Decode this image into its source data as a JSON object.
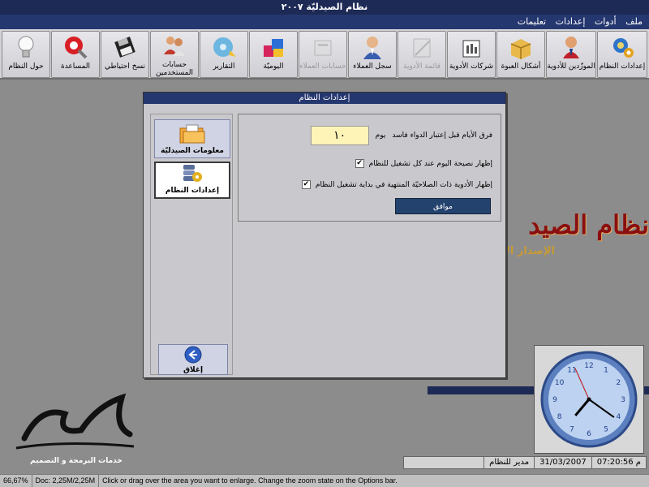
{
  "window": {
    "title": "نظام الصيدليّة ٢٠٠٧"
  },
  "menu": {
    "items": [
      "ملف",
      "أدوات",
      "إعدادات",
      "تعليمات"
    ]
  },
  "toolbar": {
    "buttons": [
      {
        "label": "إعدادات النظام",
        "icon": "gears-icon"
      },
      {
        "label": "الموزّدين للأدوية",
        "icon": "supplier-person-icon"
      },
      {
        "label": "أشكال العبوة",
        "icon": "package-box-icon"
      },
      {
        "label": "شركات الأدوية",
        "icon": "factory-icon"
      },
      {
        "label": "قائمة الأدوية",
        "icon": "drug-list-icon",
        "disabled": true
      },
      {
        "label": "سجل العملاء",
        "icon": "customer-icon"
      },
      {
        "label": "حسابات العملاء",
        "icon": "customer-accounts-icon",
        "disabled": true
      },
      {
        "label": "اليوميّة",
        "icon": "journal-blocks-icon"
      },
      {
        "label": "التقارير",
        "icon": "reports-disc-icon"
      },
      {
        "label": "حسابات المستخدمين",
        "icon": "users-icon"
      },
      {
        "label": "نسخ احتياطي",
        "icon": "floppy-disk-icon"
      },
      {
        "label": "المساعدة",
        "icon": "help-magnifier-icon"
      },
      {
        "label": "حول النظام",
        "icon": "lightbulb-icon"
      }
    ]
  },
  "background": {
    "title": "نظام الصيد",
    "subtitle": "الإصدار الأ"
  },
  "dialog": {
    "title": "إعدادات النظام",
    "side": {
      "pharmacy_info_label": "معلومات الصيدليّة",
      "system_settings_label": "إعدادات النظام",
      "close_label": "إغلاق"
    },
    "settings": {
      "expiry_label": "فرق الأيام قبل إعتبار الدواء فاسد",
      "days_value": "١٠",
      "days_unit": "يوم",
      "tip_label": "إظهار نصيحة اليوم عند كل تشغيل للنظام",
      "tip_checked": true,
      "expired_label": "إظهار الأدوية ذات الصلاحيّة المنتهية في بداية تشغيل النظام",
      "expired_checked": true,
      "ok_label": "موافق"
    }
  },
  "clock": {
    "hour": 7,
    "minute": 20,
    "second": 56
  },
  "logo": {
    "subtitle": "خدمات البرمجة و التصميم"
  },
  "statusbar": {
    "time": "م 07:20:56",
    "date": "31/03/2007",
    "user": "مدير للنظام"
  },
  "viewer": {
    "zoom": "66,67%",
    "doc": "Doc: 2,25M/2,25M",
    "hint": "Click or drag over the area you want to enlarge. Change the zoom state on the Options bar."
  },
  "colors": {
    "titlebar": "#1d2a55",
    "menubar": "#25376f",
    "ok_button": "#24426e",
    "brand": "#8a0f10"
  }
}
